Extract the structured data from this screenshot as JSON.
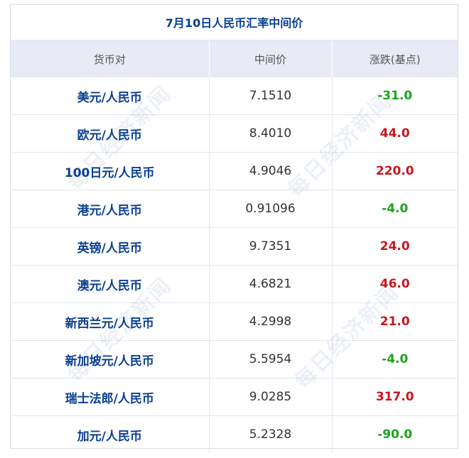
{
  "title": "7月10日人民币汇率中间价",
  "headers": [
    "货币对",
    "中间价",
    "涨跌(基点)"
  ],
  "watermark": "每日经济新闻",
  "colors": {
    "pair": "#0a3f92",
    "up": "#c8161d",
    "down": "#1aa51a",
    "header_bg": "#e8eaf6"
  },
  "rows": [
    {
      "pair": "美元/人民币",
      "rate": "7.1510",
      "change": "-31.0",
      "dir": "down"
    },
    {
      "pair": "欧元/人民币",
      "rate": "8.4010",
      "change": "44.0",
      "dir": "up"
    },
    {
      "pair": "100日元/人民币",
      "rate": "4.9046",
      "change": "220.0",
      "dir": "up"
    },
    {
      "pair": "港元/人民币",
      "rate": "0.91096",
      "change": "-4.0",
      "dir": "down"
    },
    {
      "pair": "英镑/人民币",
      "rate": "9.7351",
      "change": "24.0",
      "dir": "up"
    },
    {
      "pair": "澳元/人民币",
      "rate": "4.6821",
      "change": "46.0",
      "dir": "up"
    },
    {
      "pair": "新西兰元/人民币",
      "rate": "4.2998",
      "change": "21.0",
      "dir": "up"
    },
    {
      "pair": "新加坡元/人民币",
      "rate": "5.5954",
      "change": "-4.0",
      "dir": "down"
    },
    {
      "pair": "瑞士法郎/人民币",
      "rate": "9.0285",
      "change": "317.0",
      "dir": "up"
    },
    {
      "pair": "加元/人民币",
      "rate": "5.2328",
      "change": "-90.0",
      "dir": "down"
    }
  ]
}
